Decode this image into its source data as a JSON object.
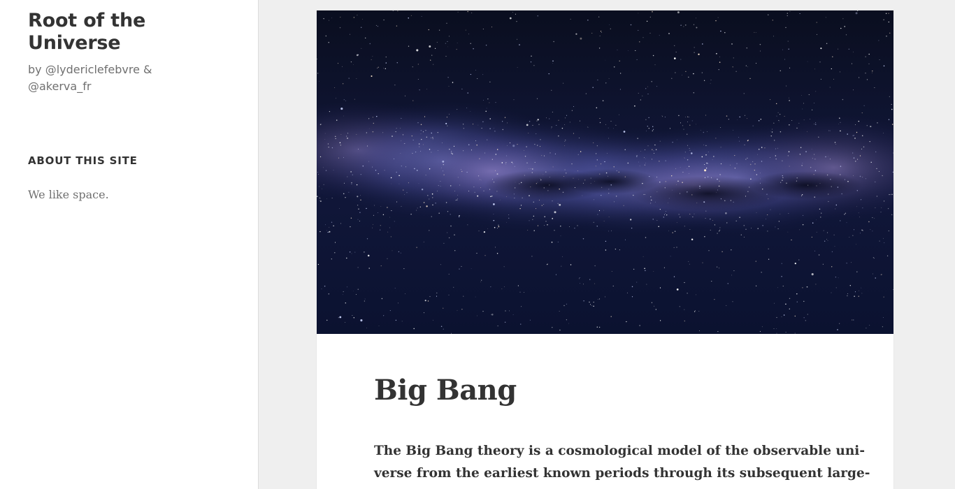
{
  "site": {
    "title": "Root of the Universe",
    "description": "by @lydericlefebvre & @akerva_fr"
  },
  "widget": {
    "title": "ABOUT THIS SITE",
    "text": "We like space."
  },
  "post": {
    "featured_image": "milky-way-starfield-photo",
    "title": "Big Bang",
    "excerpt_lines": [
      "The Big Bang theory is a cosmological model of the observable uni-",
      "verse from the earliest known periods through its subsequent large-"
    ]
  },
  "colors": {
    "page_background": "#efefef",
    "panel_background": "#ffffff",
    "text_primary": "#333333",
    "text_secondary": "#707070",
    "image_sky": "#0b0f22",
    "milky_way_band": "#5a5fa8"
  }
}
